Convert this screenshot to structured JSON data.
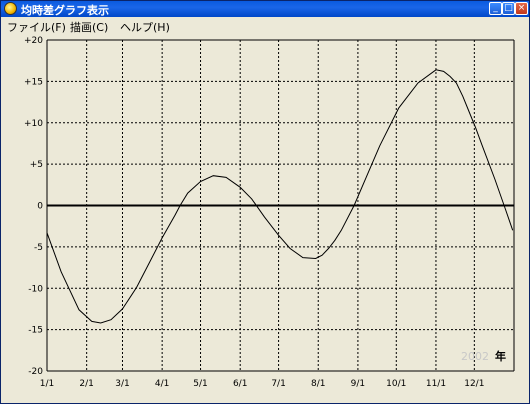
{
  "window": {
    "title": "均時差グラフ表示",
    "buttons": {
      "minimize": "_",
      "maximize": "□",
      "close": "×"
    }
  },
  "menu": [
    {
      "label": "ファイル(F)"
    },
    {
      "label": "描画(C)"
    },
    {
      "label": "ヘルプ(H)"
    }
  ],
  "graph": {
    "year": "2002",
    "year_suffix": "年"
  },
  "chart_data": {
    "type": "line",
    "ylim": [
      -20,
      20
    ],
    "y_ticks": [
      "+20",
      "+15",
      "+10",
      "+5",
      "0",
      "-5",
      "-10",
      "-15",
      "-20"
    ],
    "x_ticks": [
      "1/1",
      "2/1",
      "3/1",
      "4/1",
      "5/1",
      "6/1",
      "7/1",
      "8/1",
      "9/1",
      "10/1",
      "11/1",
      "12/1"
    ],
    "grid": true,
    "series": [
      {
        "x": [
          0,
          11,
          25,
          35,
          42,
          50,
          59,
          70,
          80,
          90,
          100,
          104,
          110,
          120,
          130,
          140,
          151,
          160,
          170,
          181,
          190,
          200,
          210,
          215,
          220,
          225,
          230,
          240,
          250,
          260,
          275,
          290,
          304,
          310,
          315,
          320,
          325,
          330,
          335,
          340,
          350,
          358,
          364
        ],
        "y": [
          -3.3,
          -8.0,
          -12.6,
          -14.0,
          -14.2,
          -13.8,
          -12.5,
          -9.9,
          -6.9,
          -3.9,
          -1.2,
          0.0,
          1.5,
          2.9,
          3.6,
          3.4,
          2.2,
          0.8,
          -1.4,
          -3.6,
          -5.2,
          -6.3,
          -6.4,
          -6.0,
          -5.2,
          -4.2,
          -3.0,
          0.0,
          3.6,
          7.2,
          11.8,
          14.8,
          16.4,
          16.2,
          15.6,
          14.8,
          13.2,
          11.3,
          9.4,
          7.3,
          3.2,
          -0.3,
          -3.0
        ]
      }
    ]
  }
}
